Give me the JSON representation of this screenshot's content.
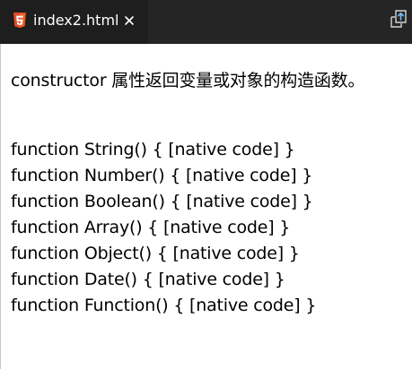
{
  "tab": {
    "title": "index2.html",
    "icon": "html5-icon",
    "close_icon": "close-icon"
  },
  "toolbar": {
    "split_icon": "open-preview-icon"
  },
  "page": {
    "intro": "constructor 属性返回变量或对象的构造函数。",
    "lines": [
      "function String() { [native code] }",
      "function Number() { [native code] }",
      "function Boolean() { [native code] }",
      "function Array() { [native code] }",
      "function Object() { [native code] }",
      "function Date() { [native code] }",
      "function Function() { [native code] }"
    ]
  },
  "colors": {
    "tabbar_bg": "#252526",
    "active_tab_bg": "#1e1e1e",
    "html5_orange": "#e44d26",
    "text": "#000000",
    "page_bg": "#ffffff"
  }
}
